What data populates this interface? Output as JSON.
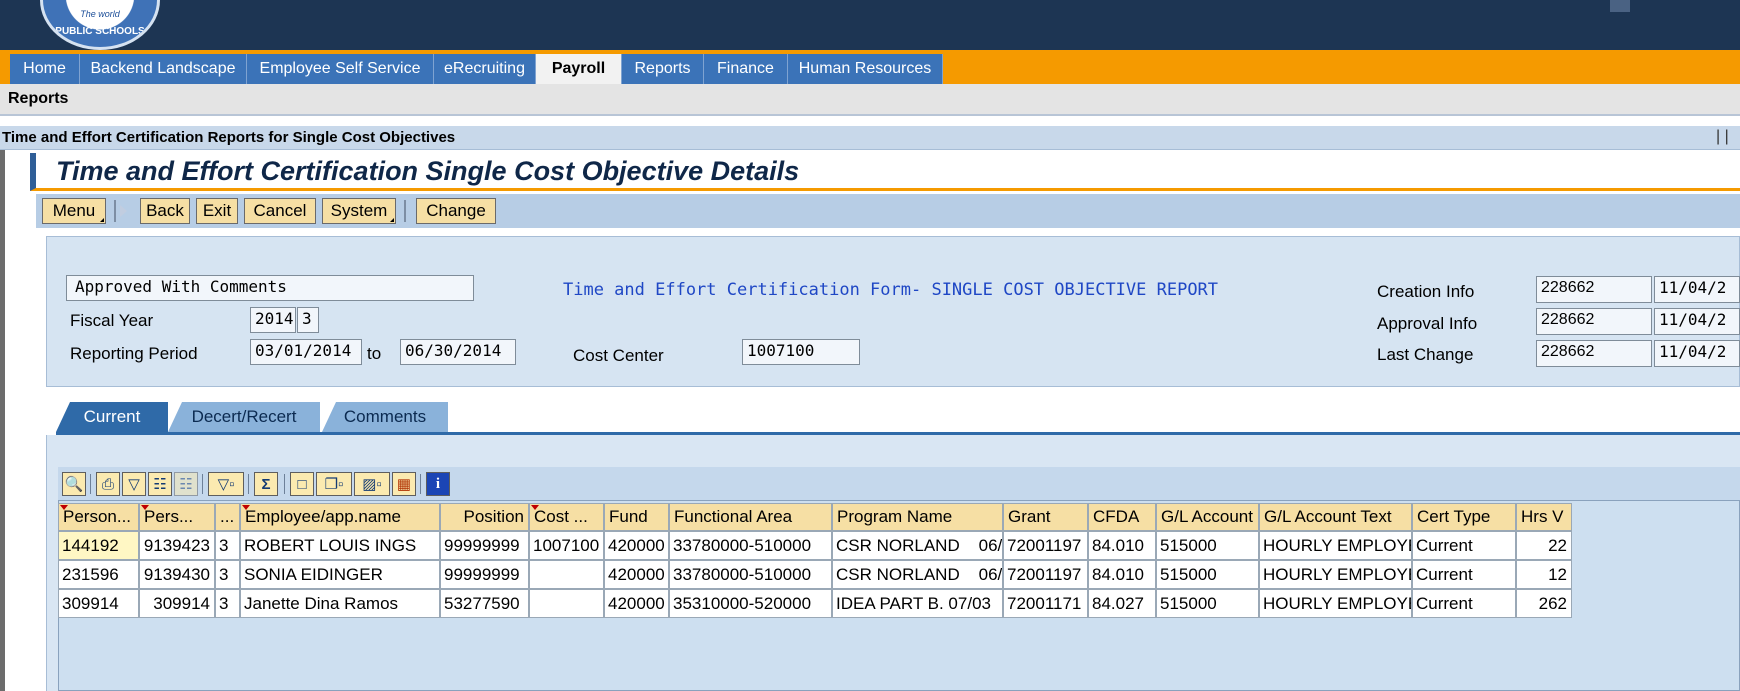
{
  "logo": {
    "line1": "The world",
    "line2": "PUBLIC SCHOOLS"
  },
  "nav": {
    "tabs": [
      {
        "label": "Home"
      },
      {
        "label": "Backend Landscape"
      },
      {
        "label": "Employee Self Service"
      },
      {
        "label": "eRecruiting"
      },
      {
        "label": "Payroll"
      },
      {
        "label": "Reports"
      },
      {
        "label": "Finance"
      },
      {
        "label": "Human Resources"
      }
    ],
    "active": "Payroll"
  },
  "subnav": {
    "label": "Reports"
  },
  "breadcrumb": "Time and Effort Certification Reports for Single Cost Objectives",
  "page_title": "Time and Effort Certification Single Cost Objective Details",
  "toolbar": {
    "menu": "Menu",
    "back": "Back",
    "exit": "Exit",
    "cancel": "Cancel",
    "system": "System",
    "change": "Change"
  },
  "header": {
    "status": "Approved With Comments",
    "form_title": "Time and Effort Certification Form- SINGLE COST OBJECTIVE REPORT",
    "fiscal_year_label": "Fiscal Year",
    "fiscal_year": "2014",
    "fiscal_period": "3",
    "reporting_period_label": "Reporting Period",
    "period_from": "03/01/2014",
    "to_label": "to",
    "period_to": "06/30/2014",
    "cost_center_label": "Cost Center",
    "cost_center": "1007100",
    "creation_label": "Creation Info",
    "creation_id": "228662",
    "creation_date": "11/04/2",
    "approval_label": "Approval Info",
    "approval_id": "228662",
    "approval_date": "11/04/2",
    "change_label": "Last Change",
    "change_id": "228662",
    "change_date": "11/04/2"
  },
  "tabs": [
    {
      "label": "Current"
    },
    {
      "label": "Decert/Recert"
    },
    {
      "label": "Comments"
    }
  ],
  "grid_icons": [
    "details-icon",
    "print-icon",
    "filter-icon",
    "find-icon",
    "find-next-icon",
    "set-filter-icon",
    "sum-icon",
    "print-preview-icon",
    "export-icon",
    "layout-icon",
    "grid-icon",
    "info-icon"
  ],
  "table": {
    "columns": [
      "Person...",
      "Pers...",
      "...",
      "Employee/app.name",
      "Position",
      "Cost ...",
      "Fund",
      "Functional Area",
      "Program Name",
      "Grant",
      "CFDA",
      "G/L Account",
      "G/L Account Text",
      "Cert Type",
      "Hrs V"
    ],
    "rows": [
      [
        "144192",
        "9139423",
        "3",
        "ROBERT LOUIS INGS",
        "99999999",
        "1007100",
        "420000",
        "33780000-510000",
        "CSR NORLAND    06/(",
        "72001197",
        "84.010",
        "515000",
        "HOURLY EMPLOYE",
        "Current",
        "22"
      ],
      [
        "231596",
        "9139430",
        "3",
        "SONIA EIDINGER",
        "99999999",
        "",
        "420000",
        "33780000-510000",
        "CSR NORLAND    06/(",
        "72001197",
        "84.010",
        "515000",
        "HOURLY EMPLOYE",
        "Current",
        "12"
      ],
      [
        "309914",
        "309914",
        "3",
        "Janette Dina Ramos",
        "53277590",
        "",
        "420000",
        "35310000-520000",
        "IDEA PART B. 07/03",
        "72001171",
        "84.027",
        "515000",
        "HOURLY EMPLOYE",
        "Current",
        "262"
      ]
    ]
  },
  "colors": {
    "banner": "#1d3553",
    "nav_orange": "#f59a00",
    "nav_blue": "#3b73b8",
    "button_yellow": "#f6dfa4",
    "panel_blue": "#d6e4f2"
  }
}
